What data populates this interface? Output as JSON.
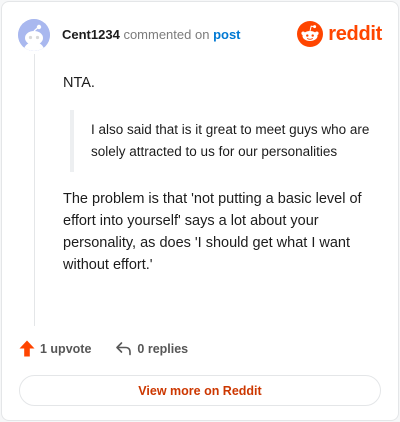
{
  "comment": {
    "author": "Cent1234",
    "verb": "commented on",
    "target_link": "post",
    "paragraphs": {
      "first": "NTA.",
      "quote": "I also said that is it great to meet guys who are solely attracted to us for our personalities",
      "second": "The problem is that 'not putting a basic level of effort into yourself' says a lot about your personality, as does 'I should get what I want without effort.'"
    }
  },
  "brand": {
    "wordmark": "reddit",
    "color": "#ff4500"
  },
  "actions": {
    "upvote_label": "1 upvote",
    "replies_label": "0 replies"
  },
  "footer": {
    "cta_label": "View more on Reddit"
  },
  "icons": {
    "avatar": "default-snoo-avatar",
    "logo": "reddit-snoo-icon",
    "upvote": "upvote-arrow-icon",
    "reply": "reply-arrow-icon"
  }
}
